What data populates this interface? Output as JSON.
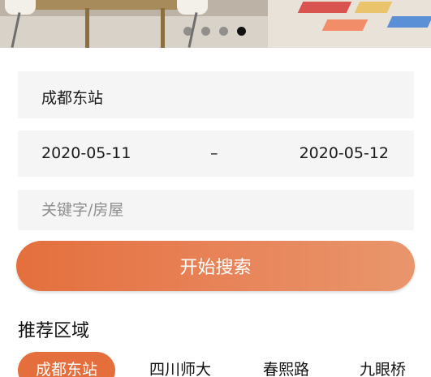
{
  "hero": {
    "carousel_total": 4,
    "carousel_active_index": 3,
    "colors": {
      "active_dot": "#111111",
      "inactive_dot": "#808080"
    }
  },
  "search_form": {
    "location": "成都东站",
    "checkin_date": "2020-05-11",
    "date_separator": "–",
    "checkout_date": "2020-05-12",
    "keyword_placeholder": "关键字/房屋",
    "search_button_label": "开始搜索"
  },
  "recommend": {
    "title": "推荐区域",
    "chips": [
      {
        "label": "成都东站",
        "active": true
      },
      {
        "label": "四川师大",
        "active": false
      },
      {
        "label": "春熙路",
        "active": false
      },
      {
        "label": "九眼桥",
        "active": false
      }
    ]
  },
  "colors": {
    "accent": "#e46f3d",
    "field_bg": "#f5f5f5"
  }
}
